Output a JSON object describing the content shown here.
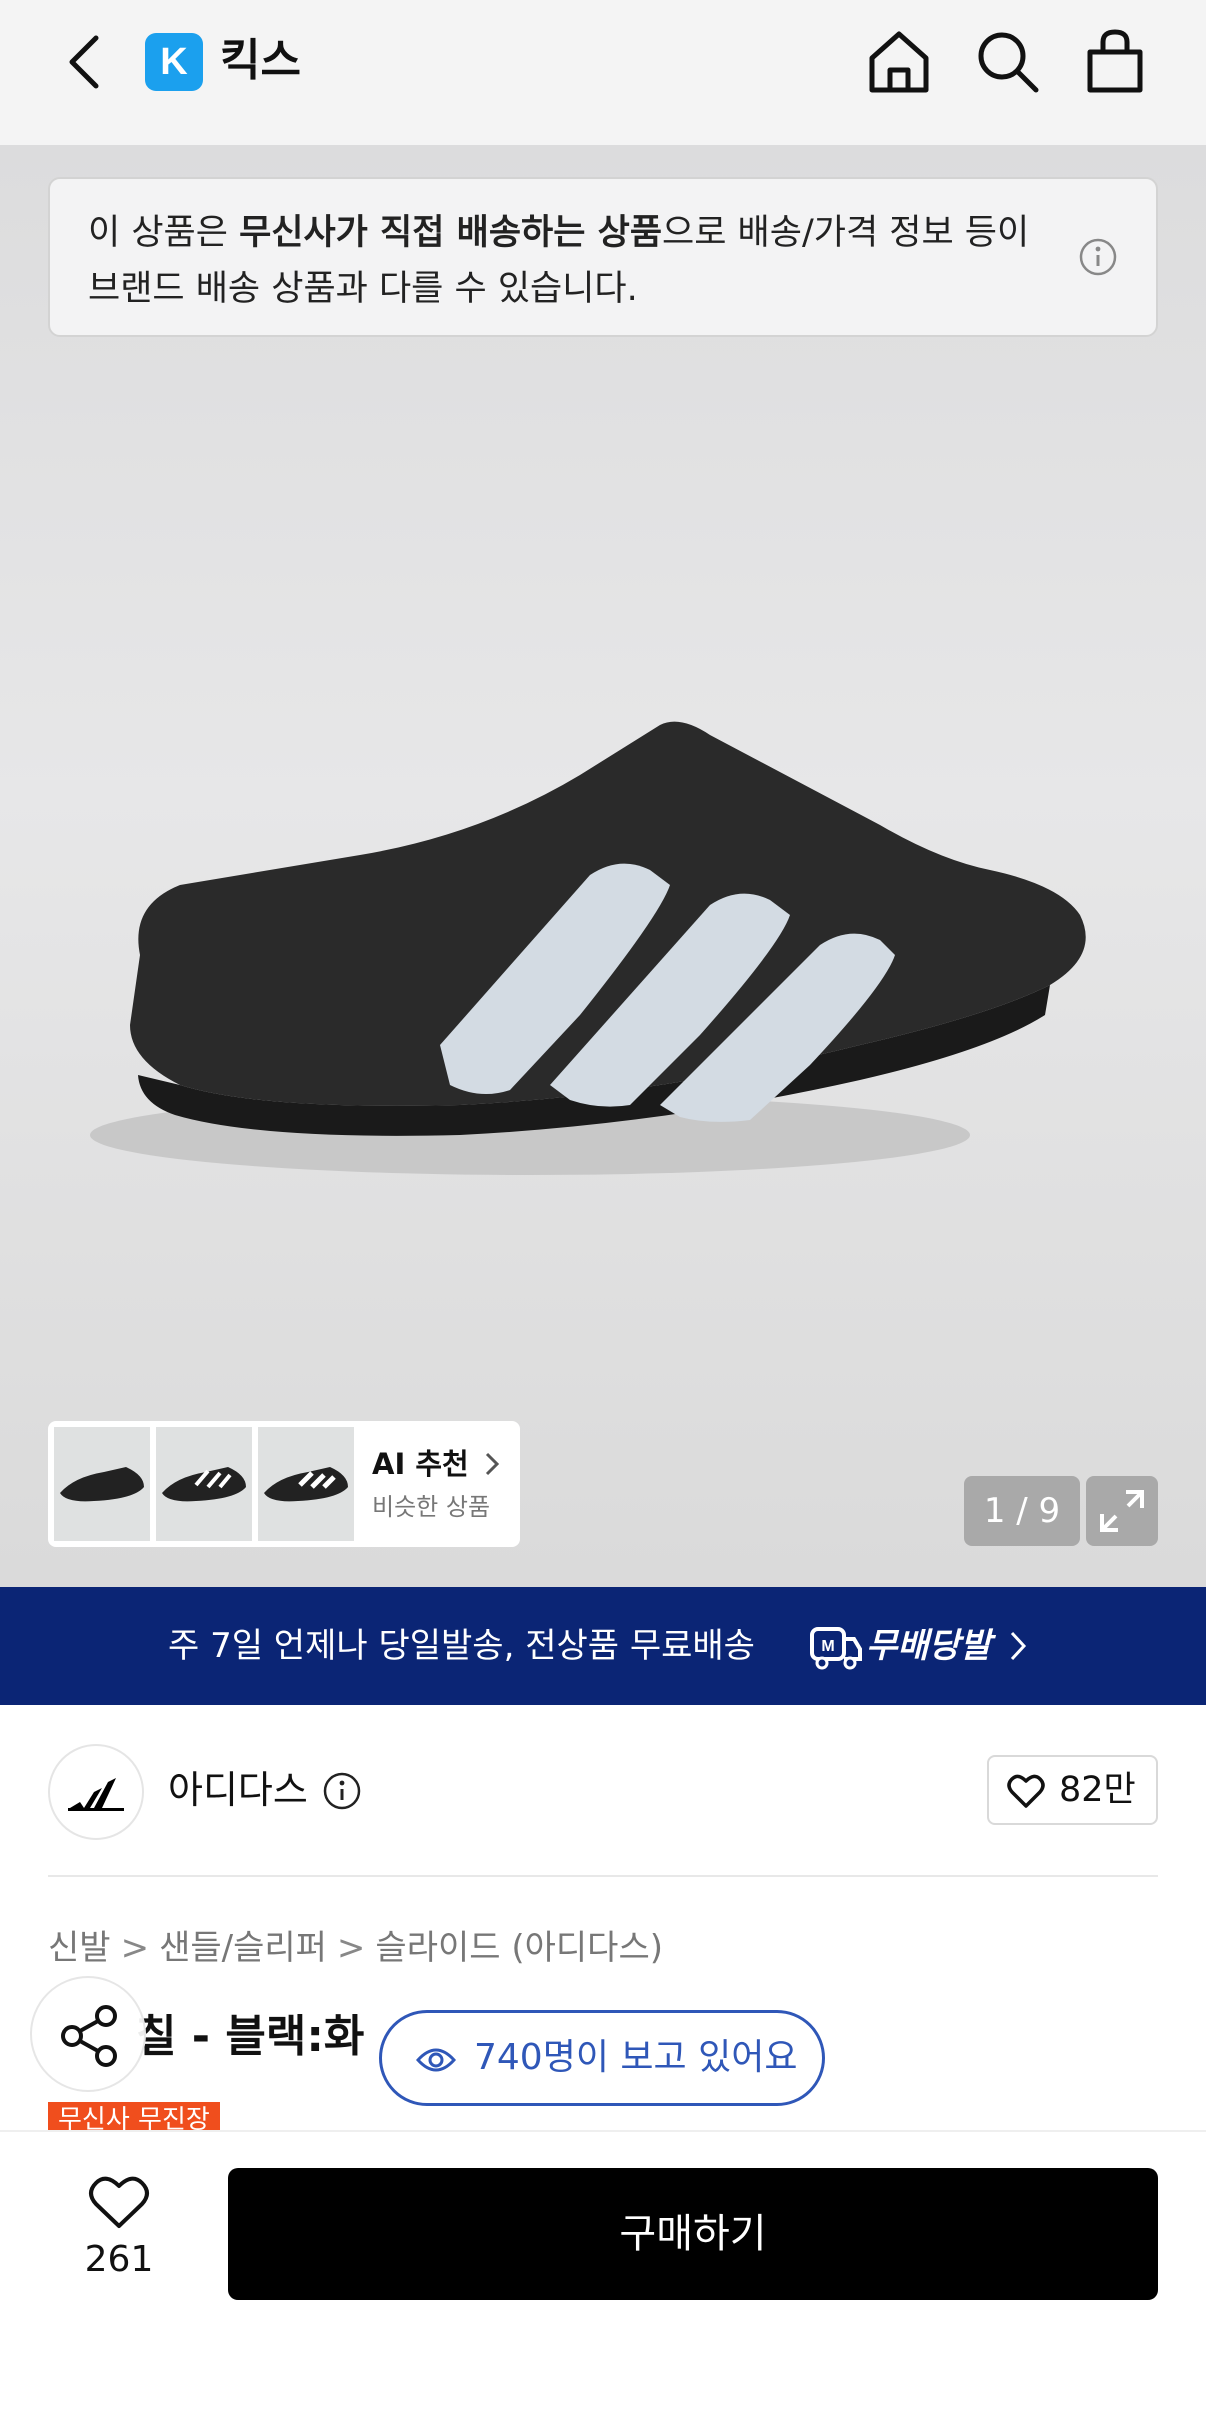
{
  "header": {
    "logo_letter": "K",
    "title": "킥스"
  },
  "notice": {
    "prefix": "이 상품은 ",
    "bold": "무신사가 직접 배송하는 상품",
    "suffix": "으로 배송/가격 정보 등이 브랜드 배송 상품과 다를 수 있습니다."
  },
  "gallery": {
    "ai_title": "AI 추천",
    "ai_subtitle": "비슷한 상품",
    "counter": "1 / 9"
  },
  "promo": {
    "text": "주 7일 언제나 당일발송, 전상품 무료배송",
    "label": "무배당발"
  },
  "brand": {
    "name": "아디다스",
    "likes": "82만"
  },
  "breadcrumb": [
    "신발",
    "샌들/슬리퍼",
    "슬라이드 (아디다스)"
  ],
  "product": {
    "title": "칠 - 블랙:화",
    "tag": "무신사 무진장"
  },
  "viewers": {
    "text": "740명이 보고 있어요"
  },
  "bottom": {
    "wish_count": "261",
    "buy_label": "구매하기"
  },
  "colors": {
    "promo_bg": "#0b2575",
    "kids_logo": "#1ba0ee",
    "viewers_accent": "#2f57b8",
    "tag_bg": "#f04e1d",
    "buy_bg": "#000000"
  }
}
